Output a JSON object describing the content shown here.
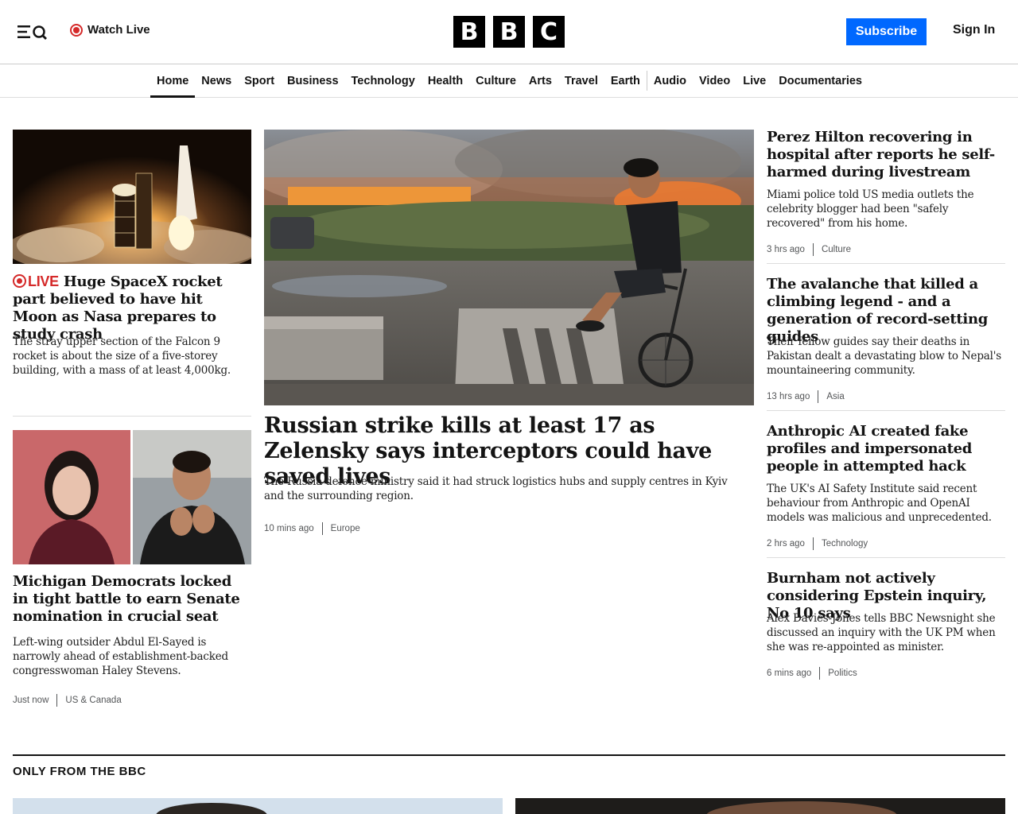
{
  "header": {
    "watch_live": "Watch Live",
    "logo": [
      "B",
      "B",
      "C"
    ],
    "subscribe": "Subscribe",
    "sign_in": "Sign In"
  },
  "nav": {
    "items": [
      "Home",
      "News",
      "Sport",
      "Business",
      "Technology",
      "Health",
      "Culture",
      "Arts",
      "Travel",
      "Earth",
      "Audio",
      "Video",
      "Live",
      "Documentaries"
    ],
    "active": "Home"
  },
  "left_col": {
    "story1": {
      "live_label": "LIVE",
      "headline": "Huge SpaceX rocket part believed to have hit Moon as Nasa prepares to study crash",
      "summary": "The stray upper section of the Falcon 9 rocket is about the size of a five-storey building, with a mass of at least 4,000kg."
    },
    "story2": {
      "headline": "Michigan Democrats locked in tight battle to earn Senate nomination in crucial seat",
      "summary": "Left-wing outsider Abdul El-Sayed is narrowly ahead of establishment-backed congresswoman Haley Stevens.",
      "time": "Just now",
      "category": "US & Canada"
    }
  },
  "lead": {
    "headline": "Russian strike kills at least 17 as Zelensky says interceptors could have saved lives",
    "summary": "The Russia defence ministry said it had struck logistics hubs and supply centres in Kyiv and the surrounding region.",
    "time": "10 mins ago",
    "category": "Europe"
  },
  "right_col": [
    {
      "headline": "Perez Hilton recovering in hospital after reports he self-harmed during livestream",
      "summary": "Miami police told US media outlets the celebrity blogger had been \"safely recovered\" from his home.",
      "time": "3 hrs ago",
      "category": "Culture"
    },
    {
      "headline": "The avalanche that killed a climbing legend - and a generation of record-setting guides",
      "summary": "Their fellow guides say their deaths in Pakistan dealt a devastating blow to Nepal's mountaineering community.",
      "time": "13 hrs ago",
      "category": "Asia"
    },
    {
      "headline": "Anthropic AI created fake profiles and impersonated people in attempted hack",
      "summary": "The UK's AI Safety Institute said recent behaviour from Anthropic and OpenAI models was malicious and unprecedented.",
      "time": "2 hrs ago",
      "category": "Technology"
    },
    {
      "headline": "Burnham not actively considering Epstein inquiry, No 10 says",
      "summary": "Alex Davies-Jones tells BBC Newsnight she discussed an inquiry with the UK PM when she was re-appointed as minister.",
      "time": "6 mins ago",
      "category": "Politics"
    }
  ],
  "section": {
    "title": "ONLY FROM THE BBC"
  },
  "colors": {
    "accent_blue": "#0068ff",
    "live_red": "#d52a2a",
    "text": "#141414"
  }
}
